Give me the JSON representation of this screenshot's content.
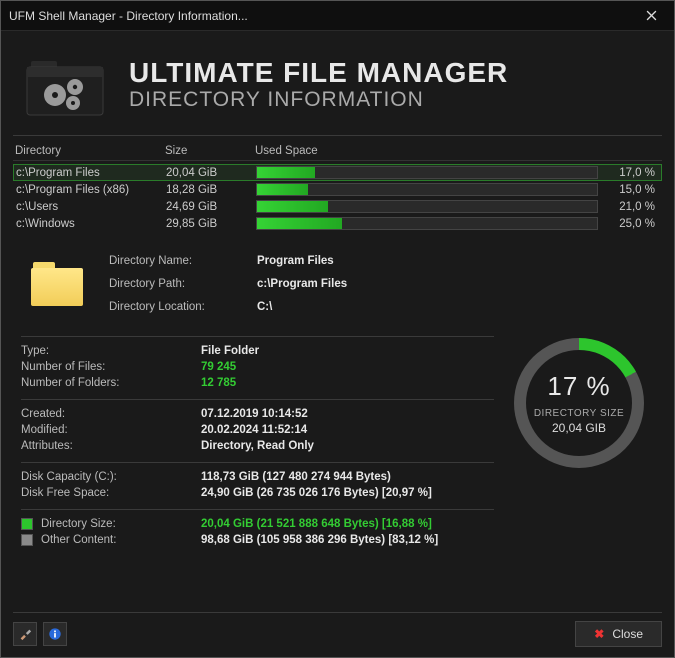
{
  "window": {
    "title": "UFM Shell Manager - Directory Information..."
  },
  "header": {
    "title": "ULTIMATE FILE MANAGER",
    "subtitle": "DIRECTORY INFORMATION"
  },
  "columns": {
    "dir": "Directory",
    "size": "Size",
    "used": "Used Space"
  },
  "rows": [
    {
      "dir": "c:\\Program Files",
      "size": "20,04 GiB",
      "pct": "17,0 %",
      "pctNum": 17.0,
      "selected": true
    },
    {
      "dir": "c:\\Program Files (x86)",
      "size": "18,28 GiB",
      "pct": "15,0 %",
      "pctNum": 15.0,
      "selected": false
    },
    {
      "dir": "c:\\Users",
      "size": "24,69 GiB",
      "pct": "21,0 %",
      "pctNum": 21.0,
      "selected": false
    },
    {
      "dir": "c:\\Windows",
      "size": "29,85 GiB",
      "pct": "25,0 %",
      "pctNum": 25.0,
      "selected": false
    }
  ],
  "detail": {
    "nameLabel": "Directory Name:",
    "name": "Program Files",
    "pathLabel": "Directory Path:",
    "path": "c:\\Program Files",
    "locLabel": "Directory Location:",
    "loc": "C:\\",
    "typeLabel": "Type:",
    "type": "File Folder",
    "nfLabel": "Number of Files:",
    "nf": "79 245",
    "ndLabel": "Number of Folders:",
    "nd": "12 785",
    "createdLabel": "Created:",
    "created": "07.12.2019 10:14:52",
    "modLabel": "Modified:",
    "mod": "20.02.2024 11:52:14",
    "attrLabel": "Attributes:",
    "attr": "Directory, Read Only",
    "capLabel": "Disk Capacity (C:):",
    "cap": "118,73 GiB (127 480 274 944 Bytes)",
    "freeLabel": "Disk Free Space:",
    "free": "24,90 GiB (26 735 026 176 Bytes) [20,97 %]",
    "dsizeLabel": "Directory Size:",
    "dsize": "20,04 GiB (21 521 888 648 Bytes) [16,88 %]",
    "otherLabel": "Other Content:",
    "other": "98,68 GiB (105 958 386 296 Bytes) [83,12 %]"
  },
  "ring": {
    "pctNum": 17,
    "pct": "17 %",
    "label": "DIRECTORY SIZE",
    "value": "20,04 GIB"
  },
  "footer": {
    "close": "Close"
  }
}
